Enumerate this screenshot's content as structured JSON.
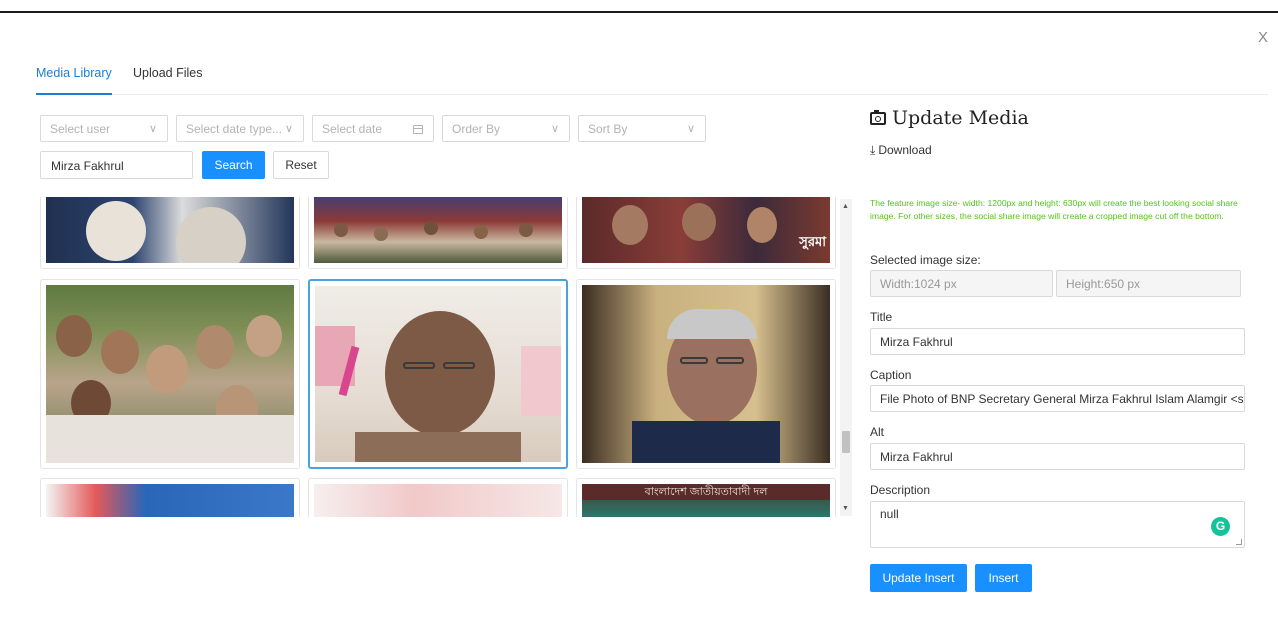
{
  "close_label": "X",
  "tabs": [
    {
      "label": "Media Library",
      "active": true
    },
    {
      "label": "Upload Files",
      "active": false
    }
  ],
  "filters": {
    "user_placeholder": "Select user",
    "date_type_placeholder": "Select date type...",
    "date_placeholder": "Select date",
    "order_placeholder": "Order By",
    "sort_placeholder": "Sort By",
    "search_value": "Mirza Fakhrul",
    "search_label": "Search",
    "reset_label": "Reset"
  },
  "media": {
    "selected_index": 4,
    "photo_text": {
      "banner_text": "সুরমা",
      "bottom_banner": "বাংলাদেশ জাতীয়তাবাদী দল"
    }
  },
  "panel": {
    "title": "Update Media",
    "download_label": "Download",
    "note": "The feature image size- width: 1200px and height: 630px will create the best looking social share image. For other sizes, the social share image will create a cropped image cut off the bottom.",
    "selected_size_label": "Selected image size:",
    "width_value": "Width:1024 px",
    "height_value": "Height:650 px",
    "title_label": "Title",
    "title_value": "Mirza Fakhrul",
    "caption_label": "Caption",
    "caption_value": "File Photo of BNP Secretary General Mirza Fakhrul Islam Alamgir <str",
    "alt_label": "Alt",
    "alt_value": "Mirza Fakhrul",
    "description_label": "Description",
    "description_value": "null",
    "grammarly_letter": "G",
    "update_insert_label": "Update Insert",
    "insert_label": "Insert"
  },
  "colors": {
    "accent": "#1890ff",
    "tab_active": "#1a7fd4",
    "note_green": "#52c41a",
    "selected_border": "#4aa3df"
  }
}
